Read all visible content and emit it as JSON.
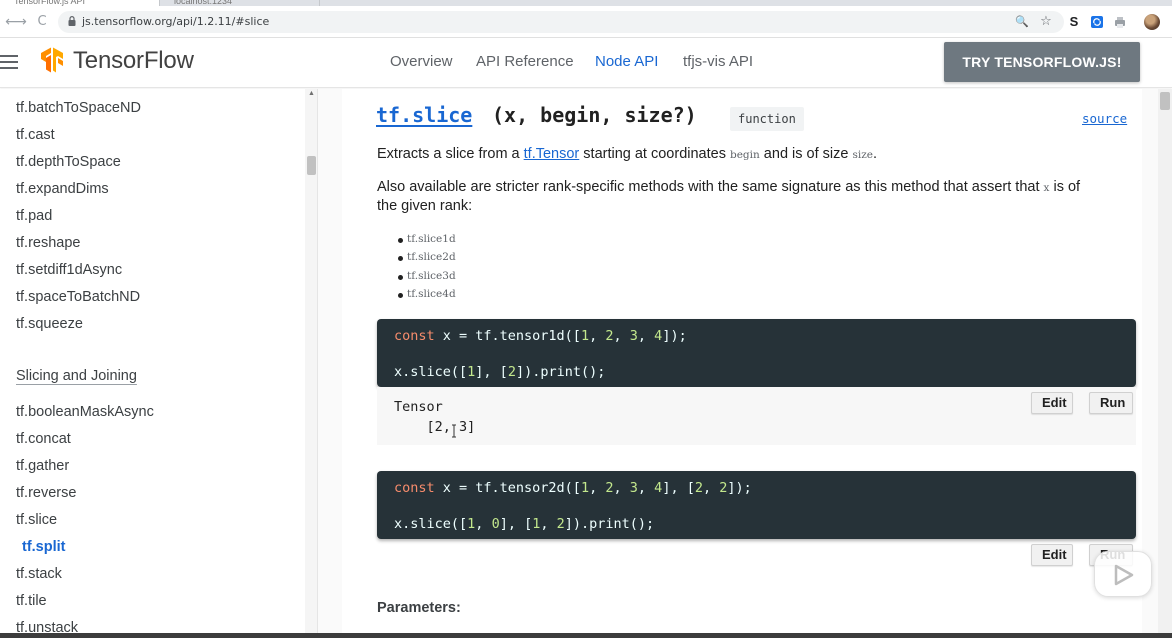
{
  "browser": {
    "tabs": [
      "TensorFlow.js API",
      "localhost:1234"
    ],
    "url": "js.tensorflow.org/api/1.2.11/#slice",
    "nav_back": "←",
    "nav_forward": "→",
    "nav_reload": "C",
    "zoom_glyph": "🔍",
    "star_glyph": "☆",
    "ext_s": "S"
  },
  "header": {
    "brand": "TensorFlow",
    "nav": [
      "Overview",
      "API Reference",
      "Node API",
      "tfjs-vis API"
    ],
    "active_nav": "Node API",
    "cta": "TRY TENSORFLOW.JS!"
  },
  "sidebar": {
    "items_top": [
      "tf.batchToSpaceND",
      "tf.cast",
      "tf.depthToSpace",
      "tf.expandDims",
      "tf.pad",
      "tf.reshape",
      "tf.setdiff1dAsync",
      "tf.spaceToBatchND",
      "tf.squeeze"
    ],
    "section_heading": "Slicing and Joining",
    "items_section": [
      "tf.booleanMaskAsync",
      "tf.concat",
      "tf.gather",
      "tf.reverse",
      "tf.slice",
      "tf.split",
      "tf.stack",
      "tf.tile",
      "tf.unstack"
    ],
    "active_item": "tf.split",
    "scroll_up": "▲"
  },
  "doc": {
    "fn_name": "tf.slice",
    "fn_signature": "(x, begin, size?)",
    "fn_kind": "function",
    "source_label": "source",
    "desc_pre": "Extracts a slice from a ",
    "desc_link": "tf.Tensor",
    "desc_mid": " starting at coordinates ",
    "desc_begin": "begin",
    "desc_mid2": " and is of size ",
    "desc_size": "size",
    "desc_end": ".",
    "also_line1_pre": "Also available are stricter rank-specific methods with the same signature as this method that assert that ",
    "also_x": "x",
    "also_line1_post": " is of",
    "also_line2": "the given rank:",
    "rank_methods": [
      "tf.slice1d",
      "tf.slice2d",
      "tf.slice3d",
      "tf.slice4d"
    ],
    "example1": {
      "line1": {
        "kw": "const",
        "a": " x = tf.tensor1d([",
        "n1": "1",
        "s1": ", ",
        "n2": "2",
        "s2": ", ",
        "n3": "3",
        "s3": ", ",
        "n4": "4",
        "e": "]);"
      },
      "line2": {
        "a": "x.slice([",
        "n1": "1",
        "b": "], [",
        "n2": "2",
        "e": "]).print();"
      },
      "output_line1": "Tensor",
      "output_line2": "    [2, 3]"
    },
    "example2": {
      "line1": {
        "kw": "const",
        "a": " x = tf.tensor2d([",
        "n1": "1",
        "s1": ", ",
        "n2": "2",
        "s2": ", ",
        "n3": "3",
        "s3": ", ",
        "n4": "4",
        "m": "], [",
        "n5": "2",
        "s5": ", ",
        "n6": "2",
        "e": "]);"
      },
      "line2": {
        "a": "x.slice([",
        "n1": "1",
        "s1": ", ",
        "n2": "0",
        "b": "], [",
        "n3": "1",
        "s3": ", ",
        "n4": "2",
        "e": "]).print();"
      }
    },
    "edit_label": "Edit",
    "run_label": "Run",
    "parameters_label": "Parameters:"
  },
  "colors": {
    "accent": "#1967d2",
    "cta_bg": "#6e7880",
    "code_bg": "#263238",
    "code_keyword": "#f78c6c",
    "code_number": "#c3e88d",
    "logo_orange": "#ff8f00"
  }
}
